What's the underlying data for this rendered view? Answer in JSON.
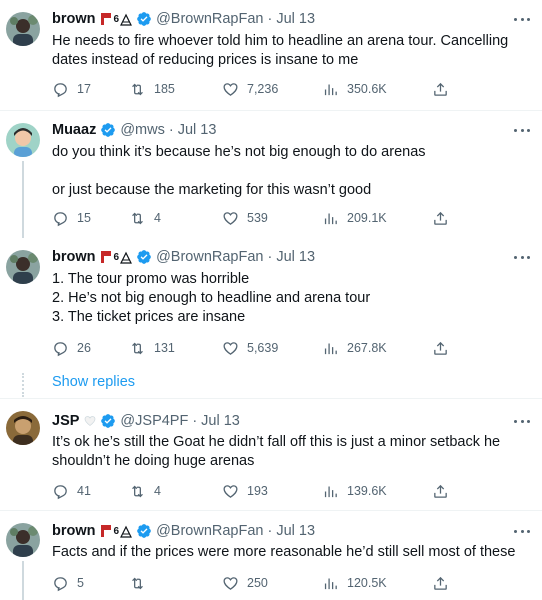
{
  "tweets": [
    {
      "name": "brown",
      "emoji_text": "6",
      "handle": "@BrownRapFan",
      "time": "Jul 13",
      "lines": [
        "He needs to fire whoever told him to headline an arena tour. Cancelling dates instead of reducing prices is insane to me"
      ],
      "replies": "17",
      "retweets": "185",
      "likes": "7,236",
      "views": "350.6K"
    },
    {
      "name": "Muaaz",
      "emoji_text": "",
      "handle": "@mws",
      "time": "Jul 13",
      "lines": [
        "do you think it’s because he’s not big enough to do arenas",
        "",
        "or just because the marketing for this wasn’t good"
      ],
      "replies": "15",
      "retweets": "4",
      "likes": "539",
      "views": "209.1K"
    },
    {
      "name": "brown",
      "emoji_text": "6",
      "handle": "@BrownRapFan",
      "time": "Jul 13",
      "lines": [
        "1. The tour promo was horrible",
        "2. He’s not big enough to headline and arena tour",
        "3. The ticket prices are insane"
      ],
      "replies": "26",
      "retweets": "131",
      "likes": "5,639",
      "views": "267.8K"
    },
    {
      "name": "JSP",
      "emoji_text": "",
      "handle": "@JSP4PF",
      "time": "Jul 13",
      "lines": [
        "It’s ok he’s still the Goat he didn’t fall off this is just a minor setback he shouldn’t he doing huge arenas"
      ],
      "replies": "41",
      "retweets": "4",
      "likes": "193",
      "views": "139.6K"
    },
    {
      "name": "brown",
      "emoji_text": "6",
      "handle": "@BrownRapFan",
      "time": "Jul 13",
      "lines": [
        "Facts and if the prices were more reasonable he’d still sell most of these"
      ],
      "replies": "5",
      "retweets": "",
      "likes": "250",
      "views": "120.5K"
    }
  ],
  "show_replies_label": "Show replies",
  "colors": {
    "accent": "#1d9bf0",
    "text": "#0f1419",
    "secondary": "#536471",
    "divider": "#eff3f4"
  }
}
